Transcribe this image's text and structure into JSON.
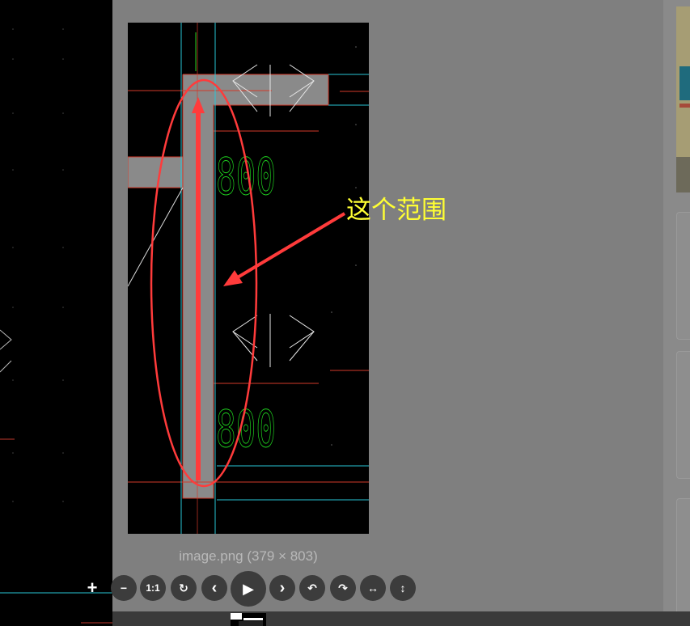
{
  "viewer": {
    "caption": "image.png (379 × 803)",
    "annotation_text": "这个范围",
    "dimension_label_1": "800",
    "dimension_label_2": "800"
  },
  "toolbar": {
    "buttons": [
      {
        "name": "zoom-in-button",
        "glyph": "+"
      },
      {
        "name": "zoom-out-button",
        "glyph": "−"
      },
      {
        "name": "actual-size-button",
        "glyph": "1:1"
      },
      {
        "name": "reset-button",
        "glyph": "↻"
      },
      {
        "name": "prev-button",
        "glyph": "‹"
      },
      {
        "name": "play-button",
        "glyph": "▶"
      },
      {
        "name": "next-button",
        "glyph": "›"
      },
      {
        "name": "rotate-left-button",
        "glyph": "↶"
      },
      {
        "name": "rotate-right-button",
        "glyph": "↷"
      },
      {
        "name": "flip-horizontal-button",
        "glyph": "↔"
      },
      {
        "name": "flip-vertical-button",
        "glyph": "↕"
      }
    ]
  },
  "colors": {
    "annotation": "#ffff33",
    "highlight": "#ff3b3b",
    "cad_green": "#1fd21f",
    "cad_cyan": "#29c6d6",
    "cad_red": "#d23a2a"
  }
}
